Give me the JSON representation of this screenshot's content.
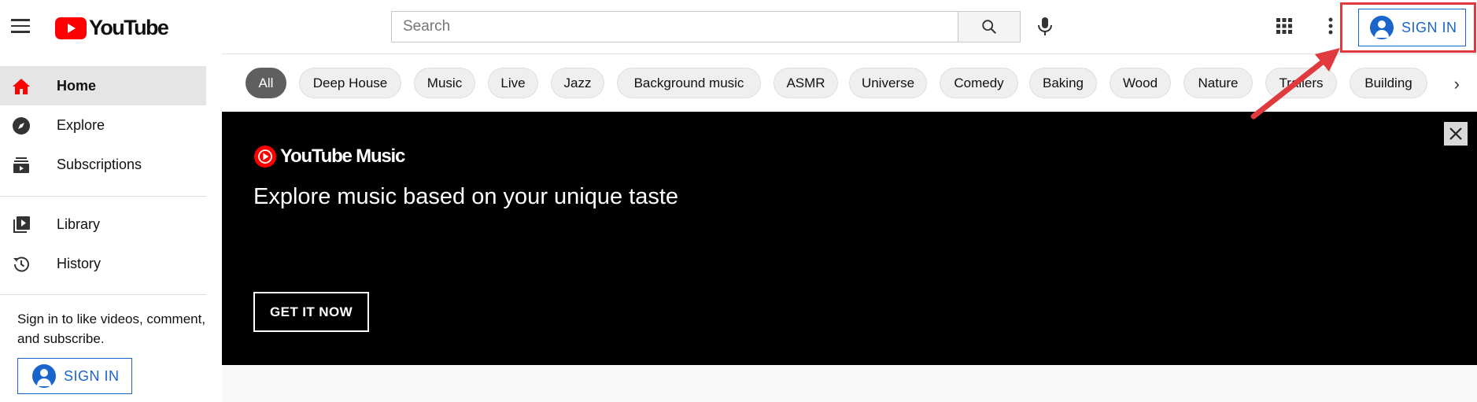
{
  "header": {
    "logo_text": "YouTube",
    "search_placeholder": "Search",
    "sign_in_label": "SIGN IN"
  },
  "sidebar": {
    "items": [
      {
        "label": "Home",
        "icon": "home-icon",
        "active": true
      },
      {
        "label": "Explore",
        "icon": "compass-icon"
      },
      {
        "label": "Subscriptions",
        "icon": "subscriptions-icon"
      },
      {
        "label": "Library",
        "icon": "library-icon"
      },
      {
        "label": "History",
        "icon": "history-icon"
      }
    ],
    "signin_prompt": "Sign in to like videos, comment, and subscribe.",
    "sign_in_label": "SIGN IN"
  },
  "chips": [
    "All",
    "Deep House",
    "Music",
    "Live",
    "Jazz",
    "Background music",
    "ASMR",
    "Universe",
    "Comedy",
    "Baking",
    "Wood",
    "Nature",
    "Trailers",
    "Building"
  ],
  "banner": {
    "logo_text": "YouTube Music",
    "title": "Explore music based on your unique taste",
    "cta_label": "GET IT NOW"
  },
  "colors": {
    "brand_red": "#ff0000",
    "accent_blue": "#1a65cc",
    "annotation_red": "#e0393e"
  }
}
